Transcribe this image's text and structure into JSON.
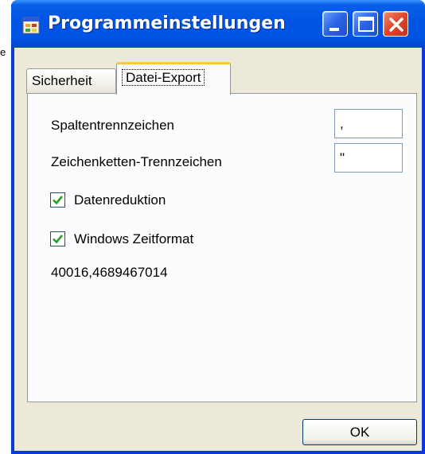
{
  "background_fragment": [
    "e"
  ],
  "window": {
    "title": "Programmeinstellungen",
    "icon": "app-window-icon",
    "controls": {
      "minimize_icon": "minimize-icon",
      "maximize_icon": "maximize-icon",
      "close_icon": "close-icon"
    }
  },
  "tabs": [
    {
      "label": "Sicherheit",
      "selected": false
    },
    {
      "label": "Datei-Export",
      "selected": true
    }
  ],
  "export": {
    "column_separator_label": "Spaltentrennzeichen",
    "column_separator_value": ",",
    "string_separator_label": "Zeichenketten-Trennzeichen",
    "string_separator_value": "\"",
    "data_reduction_label": "Datenreduktion",
    "data_reduction_checked": true,
    "windows_time_label": "Windows Zeitformat",
    "windows_time_checked": true,
    "time_value": "40016,4689467014"
  },
  "buttons": {
    "ok_label": "OK"
  },
  "colors": {
    "titlebar": "#0054e3",
    "window_bg": "#ece9d8",
    "panel_bg": "#fcfcfe",
    "tab_highlight": "#ffc83c",
    "check": "#21a121"
  }
}
